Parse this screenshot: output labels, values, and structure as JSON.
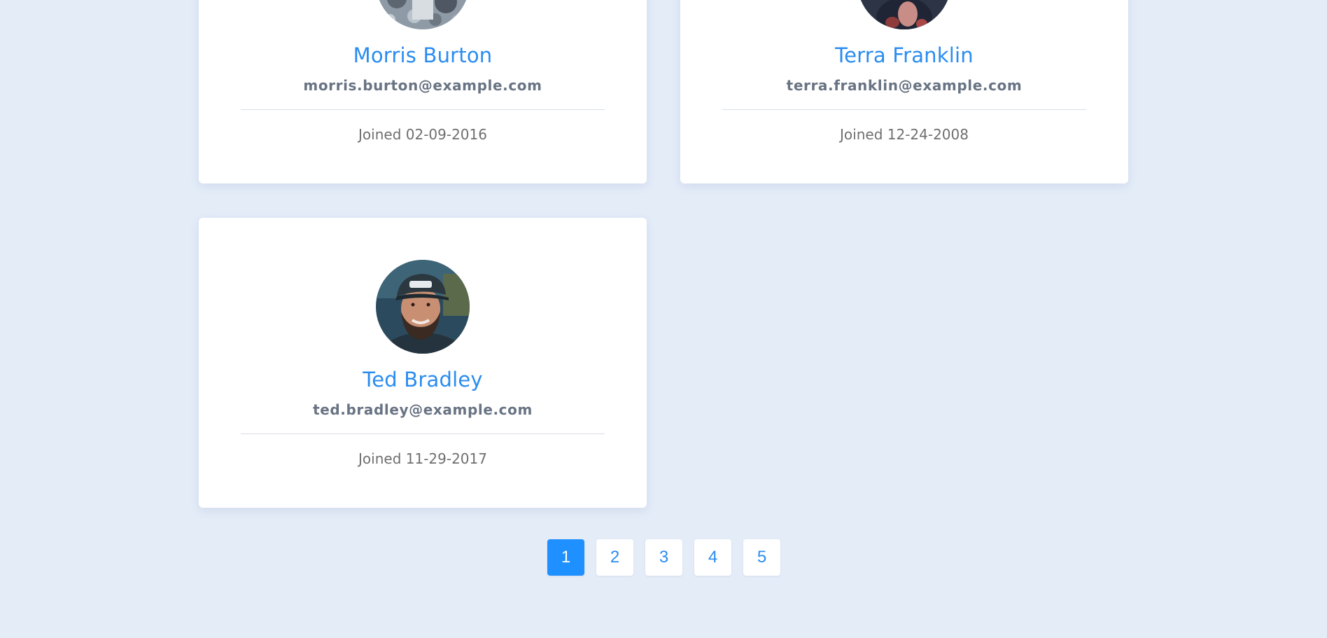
{
  "users": [
    {
      "name": "Morris Burton",
      "email": "morris.burton@example.com",
      "joined": "Joined 02-09-2016",
      "avatar_icon": "user-photo-icon"
    },
    {
      "name": "Terra Franklin",
      "email": "terra.franklin@example.com",
      "joined": "Joined 12-24-2008",
      "avatar_icon": "user-photo-icon"
    },
    {
      "name": "Ted Bradley",
      "email": "ted.bradley@example.com",
      "joined": "Joined 11-29-2017",
      "avatar_icon": "user-photo-icon"
    }
  ],
  "pagination": {
    "pages": [
      "1",
      "2",
      "3",
      "4",
      "5"
    ],
    "current": "1"
  },
  "colors": {
    "background": "#e4ecf8",
    "accent": "#2a8cf0",
    "active_page": "#1e90ff",
    "email_text": "#687383",
    "joined_text": "#6f6f6f"
  }
}
